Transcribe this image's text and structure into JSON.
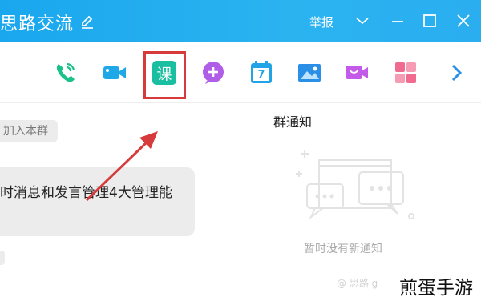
{
  "window": {
    "title": "思路交流",
    "report_label": "举报"
  },
  "toolbar": {
    "items": [
      {
        "name": "phone-call",
        "color": "#19c28a"
      },
      {
        "name": "video-call",
        "color": "#1fa8e8"
      },
      {
        "name": "course",
        "label": "课",
        "color": "#19bfa0",
        "highlighted": true
      },
      {
        "name": "add-app",
        "color": "#b05ee8"
      },
      {
        "name": "calendar",
        "label": "7",
        "color": "#21a4e6"
      },
      {
        "name": "album",
        "color": "#2a8fe6"
      },
      {
        "name": "live",
        "color": "#c45ae8"
      },
      {
        "name": "apps-grid",
        "color": "#f06b8f"
      },
      {
        "name": "more",
        "color": "#2a8fe6"
      }
    ]
  },
  "chat": {
    "join_message": "加入本群",
    "bubble_text": "时消息和发言管理4大管理能"
  },
  "notice_panel": {
    "title": "群通知",
    "empty_text": "暂时没有新通知"
  },
  "watermarks": {
    "small": "@ 思路 g",
    "large": "煎蛋手游"
  },
  "colors": {
    "titlebar": "#1aa7ee",
    "highlight_border": "#d63a3a",
    "arrow": "#d63a3a"
  }
}
